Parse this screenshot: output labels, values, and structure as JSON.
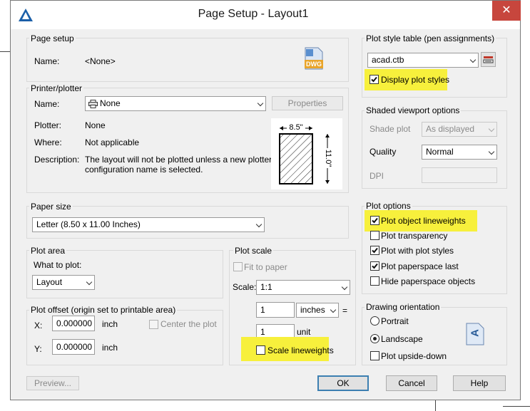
{
  "window": {
    "title": "Page Setup - Layout1",
    "close_glyph": "✕"
  },
  "page_setup": {
    "group_label": "Page setup",
    "name_label": "Name:",
    "name_value": "<None>",
    "dwg_badge": "DWG"
  },
  "printer": {
    "group_label": "Printer/plotter",
    "name_label": "Name:",
    "name_value": "None",
    "properties_label": "Properties",
    "plotter_label": "Plotter:",
    "plotter_value": "None",
    "where_label": "Where:",
    "where_value": "Not applicable",
    "description_label": "Description:",
    "description_line1": "The layout will not be plotted unless a new plotter",
    "description_line2": "configuration name is selected.",
    "preview_width": "8.5\"",
    "preview_height": "11.0\""
  },
  "paper_size": {
    "group_label": "Paper size",
    "value": "Letter (8.50 x 11.00 Inches)"
  },
  "plot_area": {
    "group_label": "Plot area",
    "what_label": "What to plot:",
    "value": "Layout"
  },
  "plot_offset": {
    "group_label": "Plot offset (origin set to printable area)",
    "x_label": "X:",
    "x_value": "0.000000",
    "x_unit": "inch",
    "y_label": "Y:",
    "y_value": "0.000000",
    "y_unit": "inch",
    "center_label": "Center the plot",
    "center_checked": false
  },
  "plot_scale": {
    "group_label": "Plot scale",
    "fit_label": "Fit to paper",
    "fit_checked": false,
    "scale_label": "Scale:",
    "scale_value": "1:1",
    "value1": "1",
    "unit1": "inches",
    "equals": "=",
    "value2": "1",
    "unit2": "unit",
    "lineweights_label": "Scale lineweights",
    "lineweights_checked": false
  },
  "plot_style_table": {
    "group_label": "Plot style table (pen assignments)",
    "value": "acad.ctb",
    "display_label": "Display plot styles",
    "display_checked": true
  },
  "shaded_viewport": {
    "group_label": "Shaded viewport options",
    "shade_label": "Shade plot",
    "shade_value": "As displayed",
    "quality_label": "Quality",
    "quality_value": "Normal",
    "dpi_label": "DPI",
    "dpi_value": ""
  },
  "plot_options": {
    "group_label": "Plot options",
    "items": [
      {
        "label": "Plot object lineweights",
        "checked": true
      },
      {
        "label": "Plot transparency",
        "checked": false
      },
      {
        "label": "Plot with plot styles",
        "checked": true
      },
      {
        "label": "Plot paperspace last",
        "checked": true
      },
      {
        "label": "Hide paperspace objects",
        "checked": false
      }
    ]
  },
  "drawing_orientation": {
    "group_label": "Drawing orientation",
    "portrait_label": "Portrait",
    "portrait_selected": false,
    "landscape_label": "Landscape",
    "landscape_selected": true,
    "upside_label": "Plot upside-down",
    "upside_checked": false,
    "orientation_glyph": "A"
  },
  "footer": {
    "preview_label": "Preview...",
    "ok_label": "OK",
    "cancel_label": "Cancel",
    "help_label": "Help"
  },
  "colors": {
    "highlight": "#f7f03c",
    "close": "#c7463d",
    "title_bg": "#ffffff",
    "dialog_bg": "#f0f0f0"
  }
}
